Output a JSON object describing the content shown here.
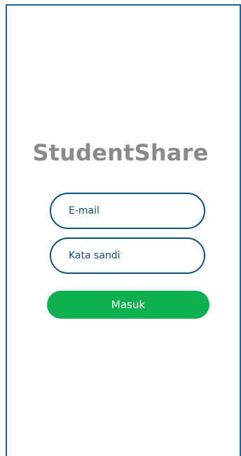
{
  "app": {
    "title": "StudentShare"
  },
  "login_form": {
    "email": {
      "placeholder": "E-mail",
      "value": ""
    },
    "password": {
      "placeholder": "Kata sandi",
      "value": ""
    },
    "submit_label": "Masuk"
  },
  "colors": {
    "frame_border": "#1f64a8",
    "title": "#8a8a8a",
    "field_border": "#0f4f82",
    "field_text": "#0f4f82",
    "button_bg": "#0fb04f",
    "button_text": "#ffffff"
  }
}
